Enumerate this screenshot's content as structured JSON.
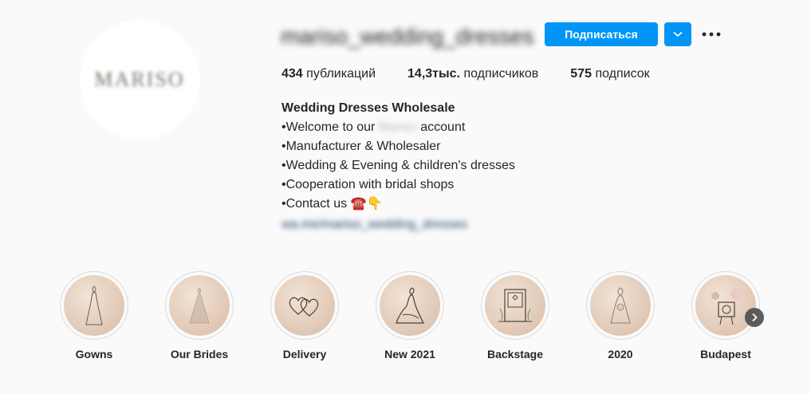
{
  "profile": {
    "username": "mariso_wedding_dresses",
    "avatar_logo": "MARISO",
    "follow_label": "Подписаться"
  },
  "stats": {
    "posts_count": "434",
    "posts_label": "публикаций",
    "followers_count": "14,3тыс.",
    "followers_label": "подписчиков",
    "following_count": "575",
    "following_label": "подписок"
  },
  "bio": {
    "name": "Wedding Dresses Wholesale",
    "line1_prefix": "•Welcome to our ",
    "line1_hidden": "Mariso",
    "line1_suffix": " account",
    "line2": "•Manufacturer & Wholesaler",
    "line3": "•Wedding & Evening & children's dresses",
    "line4": "•Cooperation with bridal shops",
    "line5": "•Contact us ☎️👇",
    "link": "wa.me/mariso_wedding_dresses"
  },
  "highlights": [
    {
      "label": "Gowns",
      "icon": "gown-icon"
    },
    {
      "label": "Our Brides",
      "icon": "bride-icon"
    },
    {
      "label": "Delivery",
      "icon": "hearts-icon"
    },
    {
      "label": "New 2021",
      "icon": "dress-sketch-icon"
    },
    {
      "label": "Backstage",
      "icon": "door-icon"
    },
    {
      "label": "2020",
      "icon": "bouquet-icon"
    },
    {
      "label": "Budapest",
      "icon": "camera-icon"
    }
  ],
  "colors": {
    "accent": "#0095f6",
    "text": "#262626",
    "background": "#fafafa",
    "highlight_fill": "#e4cdbb"
  }
}
